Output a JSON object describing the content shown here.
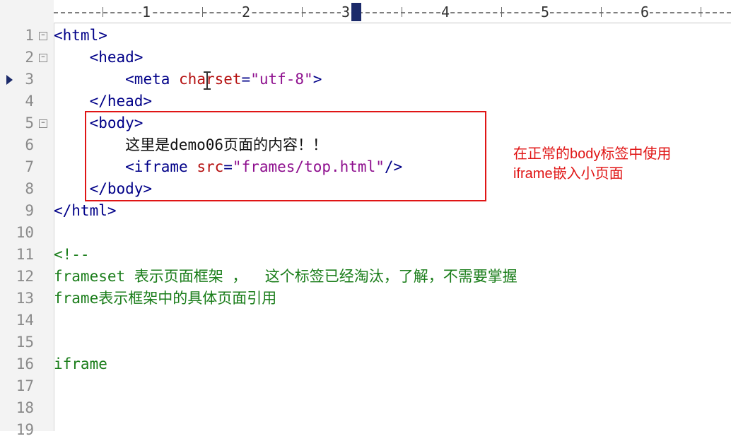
{
  "ruler": {
    "numbers": [
      "1",
      "2",
      "3",
      "4",
      "5",
      "6"
    ]
  },
  "lines": [
    {
      "no": "1",
      "tag": "<html>"
    },
    {
      "no": "2",
      "tag": "<head>"
    },
    {
      "no": "3",
      "open": "<meta",
      "attr": "charset",
      "eq": "=",
      "val": "\"utf-8\"",
      "close": ">"
    },
    {
      "no": "4",
      "tag": "</head>"
    },
    {
      "no": "5",
      "tag": "<body>"
    },
    {
      "no": "6",
      "text": "这里是demo06页面的内容！！"
    },
    {
      "no": "7",
      "open": "<iframe",
      "attr": "src",
      "eq": "=",
      "val": "\"frames/top.html\"",
      "close": "/>"
    },
    {
      "no": "8",
      "tag": "</body>"
    },
    {
      "no": "9",
      "tag": "</html>"
    },
    {
      "no": "10"
    },
    {
      "no": "11",
      "text": "<!--"
    },
    {
      "no": "12",
      "text": "frameset 表示页面框架 ，  这个标签已经淘汰，了解，不需要掌握"
    },
    {
      "no": "13",
      "text": "frame表示框架中的具体页面引用"
    },
    {
      "no": "14"
    },
    {
      "no": "15"
    },
    {
      "no": "16",
      "text": "iframe"
    },
    {
      "no": "17"
    },
    {
      "no": "18"
    },
    {
      "no": "19"
    }
  ],
  "annotation": {
    "text": "在正常的body标签中使用\niframe嵌入小页面",
    "color": "#e01515"
  }
}
